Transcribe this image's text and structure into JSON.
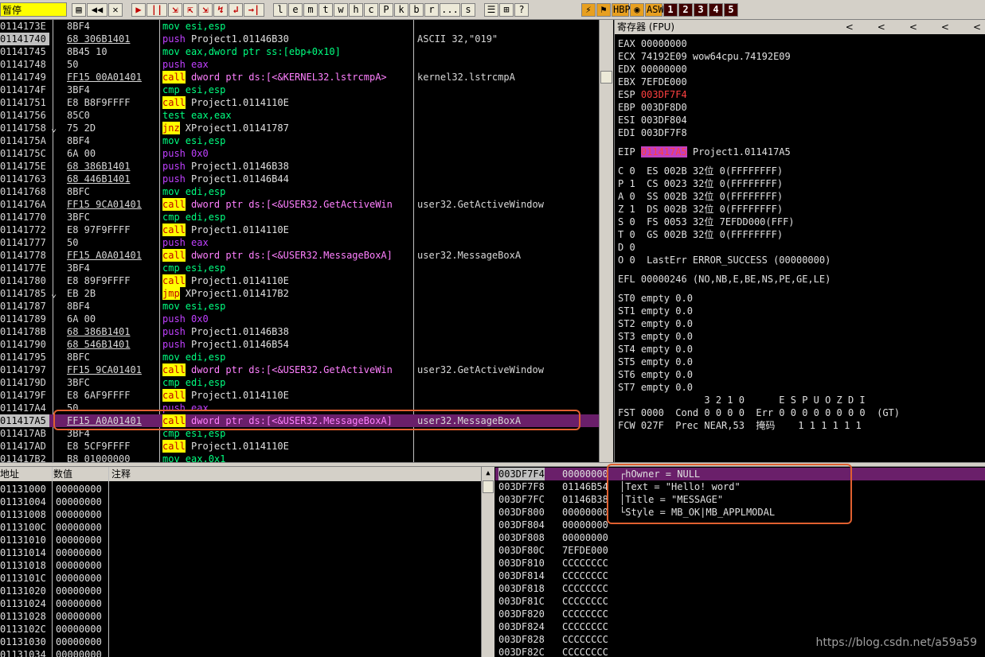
{
  "toolbar": {
    "status": "暂停",
    "buttons": [
      "▤",
      "◀◀",
      "✕",
      "▶",
      "||",
      "⇲",
      "⇱",
      "⇲",
      "↯",
      "↲",
      "→|",
      "l",
      "e",
      "m",
      "t",
      "w",
      "h",
      "c",
      "P",
      "k",
      "b",
      "r",
      "...",
      "s",
      "☰",
      "⊞",
      "?"
    ],
    "right_buttons": [
      "⚡",
      "⚑",
      "HBP",
      "◉",
      "ASW",
      "1",
      "2",
      "3",
      "4",
      "5"
    ]
  },
  "cpu": {
    "rows": [
      {
        "addr": "0114173E",
        "hex": "8BF4",
        "mn": "mov",
        "ops": "esi,esp",
        "kind": "mov",
        "cmt": ""
      },
      {
        "addr": "01141740",
        "hex": "68 306B1401",
        "mn": "push",
        "ops": "Project1.01146B30",
        "kind": "push",
        "cmt": "ASCII 32,\"019\"",
        "addr_hl": true
      },
      {
        "addr": "01141745",
        "hex": "8B45 10",
        "mn": "mov",
        "ops": "eax,dword ptr ss:[ebp+0x10]",
        "kind": "mov",
        "cmt": ""
      },
      {
        "addr": "01141748",
        "hex": "50",
        "mn": "push",
        "ops": "eax",
        "kind": "push2",
        "cmt": ""
      },
      {
        "addr": "01141749",
        "hex": "FF15 00A01401",
        "mn": "call",
        "ops": "dword ptr ds:[<&KERNEL32.lstrcmpA>",
        "kind": "call2",
        "cmt": "kernel32.lstrcmpA"
      },
      {
        "addr": "0114174F",
        "hex": "3BF4",
        "mn": "cmp",
        "ops": "esi,esp",
        "kind": "cmp",
        "cmt": ""
      },
      {
        "addr": "01141751",
        "hex": "E8 B8F9FFFF",
        "mn": "call",
        "ops": "Project1.0114110E",
        "kind": "call",
        "cmt": ""
      },
      {
        "addr": "01141756",
        "hex": "85C0",
        "mn": "test",
        "ops": "eax,eax",
        "kind": "mov",
        "cmt": ""
      },
      {
        "addr": "01141758",
        "hex": "75 2D",
        "mn": "jnz",
        "ops": "XProject1.01141787",
        "kind": "jcc",
        "cmt": ""
      },
      {
        "addr": "0114175A",
        "hex": "8BF4",
        "mn": "mov",
        "ops": "esi,esp",
        "kind": "mov",
        "cmt": ""
      },
      {
        "addr": "0114175C",
        "hex": "6A 00",
        "mn": "push",
        "ops": "0x0",
        "kind": "push2",
        "cmt": ""
      },
      {
        "addr": "0114175E",
        "hex": "68 386B1401",
        "mn": "push",
        "ops": "Project1.01146B38",
        "kind": "push",
        "cmt": ""
      },
      {
        "addr": "01141763",
        "hex": "68 446B1401",
        "mn": "push",
        "ops": "Project1.01146B44",
        "kind": "push",
        "cmt": ""
      },
      {
        "addr": "01141768",
        "hex": "8BFC",
        "mn": "mov",
        "ops": "edi,esp",
        "kind": "mov",
        "cmt": ""
      },
      {
        "addr": "0114176A",
        "hex": "FF15 9CA01401",
        "mn": "call",
        "ops": "dword ptr ds:[<&USER32.GetActiveWin",
        "kind": "call2",
        "cmt": "user32.GetActiveWindow"
      },
      {
        "addr": "01141770",
        "hex": "3BFC",
        "mn": "cmp",
        "ops": "edi,esp",
        "kind": "cmp",
        "cmt": ""
      },
      {
        "addr": "01141772",
        "hex": "E8 97F9FFFF",
        "mn": "call",
        "ops": "Project1.0114110E",
        "kind": "call",
        "cmt": ""
      },
      {
        "addr": "01141777",
        "hex": "50",
        "mn": "push",
        "ops": "eax",
        "kind": "push2",
        "cmt": ""
      },
      {
        "addr": "01141778",
        "hex": "FF15 A0A01401",
        "mn": "call",
        "ops": "dword ptr ds:[<&USER32.MessageBoxA]",
        "kind": "call2",
        "cmt": "user32.MessageBoxA"
      },
      {
        "addr": "0114177E",
        "hex": "3BF4",
        "mn": "cmp",
        "ops": "esi,esp",
        "kind": "cmp",
        "cmt": ""
      },
      {
        "addr": "01141780",
        "hex": "E8 89F9FFFF",
        "mn": "call",
        "ops": "Project1.0114110E",
        "kind": "call",
        "cmt": ""
      },
      {
        "addr": "01141785",
        "hex": "EB 2B",
        "mn": "jmp",
        "ops": "XProject1.011417B2",
        "kind": "jcc",
        "cmt": ""
      },
      {
        "addr": "01141787",
        "hex": "8BF4",
        "mn": "mov",
        "ops": "esi,esp",
        "kind": "mov",
        "cmt": ""
      },
      {
        "addr": "01141789",
        "hex": "6A 00",
        "mn": "push",
        "ops": "0x0",
        "kind": "push2",
        "cmt": ""
      },
      {
        "addr": "0114178B",
        "hex": "68 386B1401",
        "mn": "push",
        "ops": "Project1.01146B38",
        "kind": "push",
        "cmt": ""
      },
      {
        "addr": "01141790",
        "hex": "68 546B1401",
        "mn": "push",
        "ops": "Project1.01146B54",
        "kind": "push",
        "cmt": ""
      },
      {
        "addr": "01141795",
        "hex": "8BFC",
        "mn": "mov",
        "ops": "edi,esp",
        "kind": "mov",
        "cmt": ""
      },
      {
        "addr": "01141797",
        "hex": "FF15 9CA01401",
        "mn": "call",
        "ops": "dword ptr ds:[<&USER32.GetActiveWin",
        "kind": "call2",
        "cmt": "user32.GetActiveWindow"
      },
      {
        "addr": "0114179D",
        "hex": "3BFC",
        "mn": "cmp",
        "ops": "edi,esp",
        "kind": "cmp",
        "cmt": ""
      },
      {
        "addr": "0114179F",
        "hex": "E8 6AF9FFFF",
        "mn": "call",
        "ops": "Project1.0114110E",
        "kind": "call",
        "cmt": ""
      },
      {
        "addr": "011417A4",
        "hex": "50",
        "mn": "push",
        "ops": "eax",
        "kind": "push2",
        "cmt": ""
      },
      {
        "addr": "011417A5",
        "hex": "FF15 A0A01401",
        "mn": "call",
        "ops": "dword ptr ds:[<&USER32.MessageBoxA]",
        "kind": "call2",
        "cmt": "user32.MessageBoxA",
        "sel": true
      },
      {
        "addr": "011417AB",
        "hex": "3BF4",
        "mn": "cmp",
        "ops": "esi,esp",
        "kind": "cmp",
        "cmt": ""
      },
      {
        "addr": "011417AD",
        "hex": "E8 5CF9FFFF",
        "mn": "call",
        "ops": "Project1.0114110E",
        "kind": "call",
        "cmt": ""
      },
      {
        "addr": "011417B2",
        "hex": "B8 01000000",
        "mn": "mov",
        "ops": "eax,0x1",
        "kind": "mov",
        "cmt": ""
      }
    ],
    "jump_marks": {
      "01141758": "⌄",
      "01141785": "⌄"
    }
  },
  "registers": {
    "title": "寄存器 (FPU)",
    "arrows": [
      "<",
      "<",
      "<",
      "<",
      "<"
    ],
    "lines": [
      {
        "t": "EAX 00000000"
      },
      {
        "t": "ECX 74192E09 wow64cpu.74192E09"
      },
      {
        "t": "EDX 00000000"
      },
      {
        "t": "EBX 7EFDE000"
      },
      {
        "t": "ESP ",
        "v": "003DF7F4",
        "red": true
      },
      {
        "t": "EBP 003DF8D0"
      },
      {
        "t": "ESI 003DF804"
      },
      {
        "t": "EDI 003DF7F8"
      },
      {
        "t": ""
      },
      {
        "t": "EIP ",
        "eip": "011417A5",
        "after": " Project1.011417A5"
      },
      {
        "t": ""
      },
      {
        "t": "C 0  ES 002B 32位 0(FFFFFFFF)"
      },
      {
        "t": "P 1  CS 0023 32位 0(FFFFFFFF)"
      },
      {
        "t": "A 0  SS 002B 32位 0(FFFFFFFF)"
      },
      {
        "t": "Z 1  DS 002B 32位 0(FFFFFFFF)"
      },
      {
        "t": "S 0  FS 0053 32位 7EFDD000(FFF)"
      },
      {
        "t": "T 0  GS 002B 32位 0(FFFFFFFF)"
      },
      {
        "t": "D 0"
      },
      {
        "t": "O 0  LastErr ERROR_SUCCESS (00000000)"
      },
      {
        "t": ""
      },
      {
        "t": "EFL 00000246 (NO,NB,E,BE,NS,PE,GE,LE)"
      },
      {
        "t": ""
      },
      {
        "t": "ST0 empty 0.0"
      },
      {
        "t": "ST1 empty 0.0"
      },
      {
        "t": "ST2 empty 0.0"
      },
      {
        "t": "ST3 empty 0.0"
      },
      {
        "t": "ST4 empty 0.0"
      },
      {
        "t": "ST5 empty 0.0"
      },
      {
        "t": "ST6 empty 0.0"
      },
      {
        "t": "ST7 empty 0.0"
      },
      {
        "t": "               3 2 1 0      E S P U O Z D I"
      },
      {
        "t": "FST 0000  Cond 0 0 0 0  Err 0 0 0 0 0 0 0 0  (GT)"
      },
      {
        "t": "FCW 027F  Prec NEAR,53  掩码    1 1 1 1 1 1"
      }
    ]
  },
  "dump": {
    "headers": [
      "地址",
      "数值",
      "注释"
    ],
    "rows": [
      [
        "01131000",
        "00000000"
      ],
      [
        "01131004",
        "00000000"
      ],
      [
        "01131008",
        "00000000"
      ],
      [
        "0113100C",
        "00000000"
      ],
      [
        "01131010",
        "00000000"
      ],
      [
        "01131014",
        "00000000"
      ],
      [
        "01131018",
        "00000000"
      ],
      [
        "0113101C",
        "00000000"
      ],
      [
        "01131020",
        "00000000"
      ],
      [
        "01131024",
        "00000000"
      ],
      [
        "01131028",
        "00000000"
      ],
      [
        "0113102C",
        "00000000"
      ],
      [
        "01131030",
        "00000000"
      ],
      [
        "01131034",
        "00000000"
      ]
    ]
  },
  "stack": {
    "rows": [
      {
        "addr": "003DF7F4",
        "val": "00000000",
        "cmt": "┌hOwner = NULL",
        "sel": true
      },
      {
        "addr": "003DF7F8",
        "val": "01146B54",
        "cmt": "│Text = \"Hello! word\""
      },
      {
        "addr": "003DF7FC",
        "val": "01146B38",
        "cmt": "│Title = \"MESSAGE\""
      },
      {
        "addr": "003DF800",
        "val": "00000000",
        "cmt": "└Style = MB_OK|MB_APPLMODAL"
      },
      {
        "addr": "003DF804",
        "val": "00000000",
        "cmt": ""
      },
      {
        "addr": "003DF808",
        "val": "00000000",
        "cmt": ""
      },
      {
        "addr": "003DF80C",
        "val": "7EFDE000",
        "cmt": ""
      },
      {
        "addr": "003DF810",
        "val": "CCCCCCCC",
        "cmt": ""
      },
      {
        "addr": "003DF814",
        "val": "CCCCCCCC",
        "cmt": ""
      },
      {
        "addr": "003DF818",
        "val": "CCCCCCCC",
        "cmt": ""
      },
      {
        "addr": "003DF81C",
        "val": "CCCCCCCC",
        "cmt": ""
      },
      {
        "addr": "003DF820",
        "val": "CCCCCCCC",
        "cmt": ""
      },
      {
        "addr": "003DF824",
        "val": "CCCCCCCC",
        "cmt": ""
      },
      {
        "addr": "003DF828",
        "val": "CCCCCCCC",
        "cmt": ""
      },
      {
        "addr": "003DF82C",
        "val": "CCCCCCCC",
        "cmt": ""
      }
    ]
  },
  "watermark": "https://blog.csdn.net/a59a59",
  "colors": {
    "selection": "#6a1f6a",
    "annotation": "#e06030",
    "toolbar": "#d4d0c8"
  }
}
